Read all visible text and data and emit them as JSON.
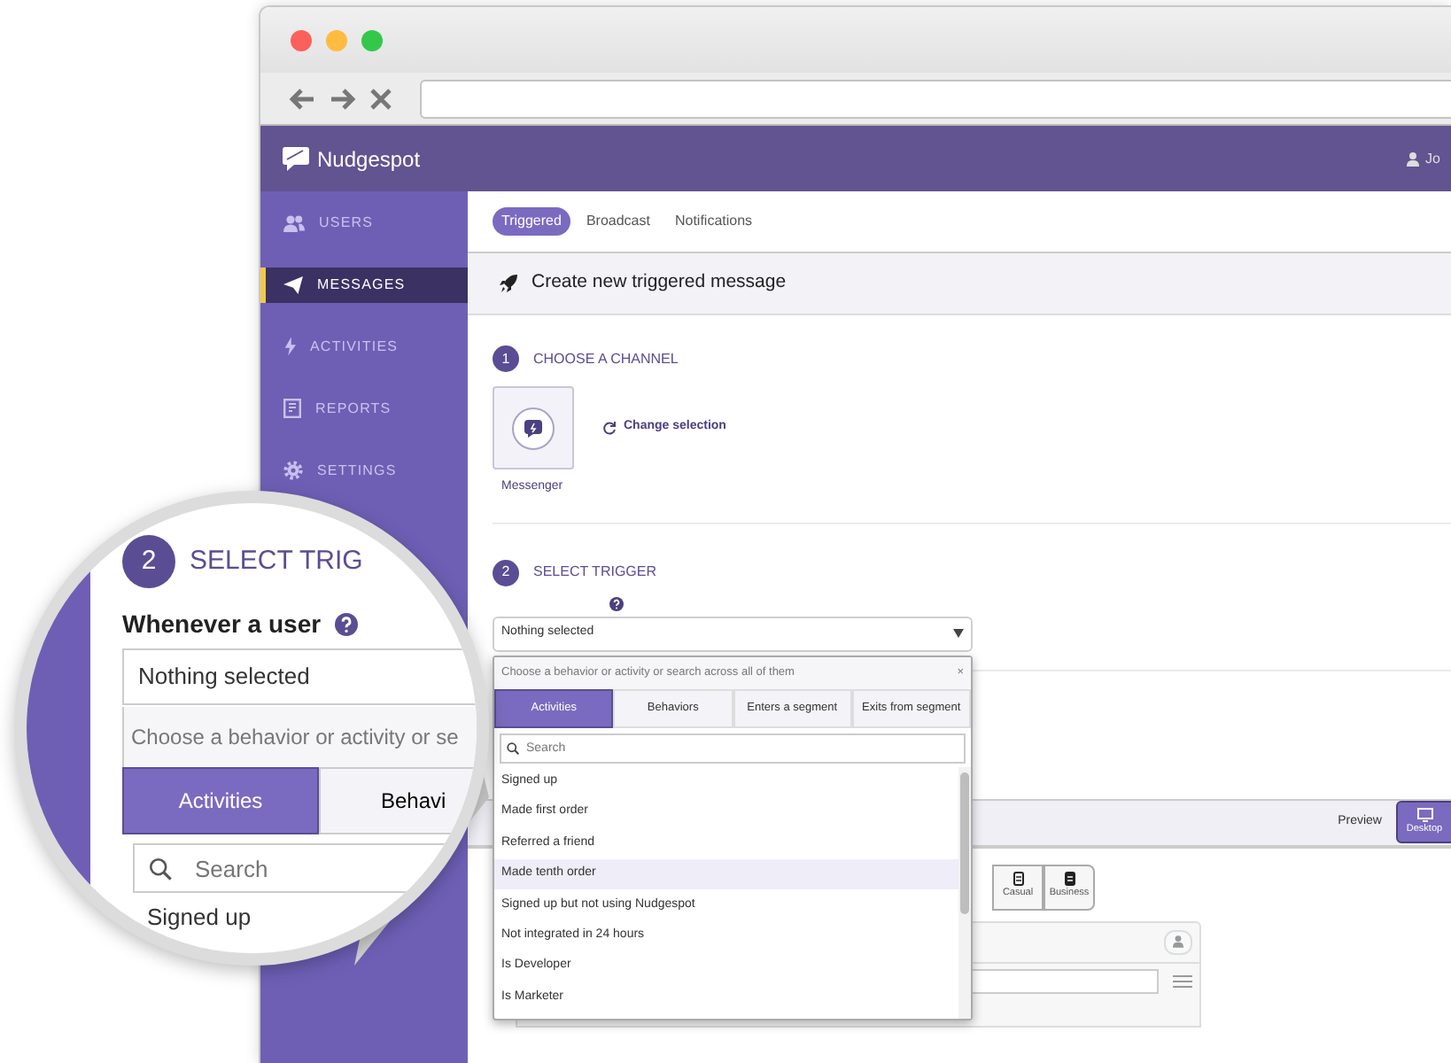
{
  "app": {
    "brand": "Nudgespot",
    "user": "Jo"
  },
  "sidebar": {
    "items": [
      {
        "label": "USERS",
        "selected": false
      },
      {
        "label": "MESSAGES",
        "selected": true
      },
      {
        "label": "ACTIVITIES",
        "selected": false
      },
      {
        "label": "REPORTS",
        "selected": false
      },
      {
        "label": "SETTINGS",
        "selected": false
      }
    ]
  },
  "tabs": [
    {
      "label": "Triggered",
      "selected": true
    },
    {
      "label": "Broadcast",
      "selected": false
    },
    {
      "label": "Notifications",
      "selected": false
    }
  ],
  "page_title": "Create new triggered message",
  "steps": [
    {
      "number": "1",
      "title": "CHOOSE A CHANNEL"
    },
    {
      "number": "2",
      "title": "SELECT TRIGGER"
    }
  ],
  "channel": {
    "label": "Messenger",
    "change_link": "Change selection"
  },
  "trigger_select": {
    "value": "Nothing selected",
    "open": true
  },
  "dropdown": {
    "hint": "Choose a behavior or activity or search across all of them",
    "close": "×",
    "tabs": [
      {
        "label": "Activities",
        "selected": true
      },
      {
        "label": "Behaviors",
        "selected": false
      },
      {
        "label": "Enters a segment",
        "selected": false
      },
      {
        "label": "Exits from segment",
        "selected": false
      }
    ],
    "search": {
      "placeholder": "Search"
    },
    "options": [
      {
        "label": "Signed up",
        "selected": false
      },
      {
        "label": "Made first order",
        "selected": false
      },
      {
        "label": "Referred a friend",
        "selected": false
      },
      {
        "label": "Made tenth order",
        "selected": true
      },
      {
        "label": "Signed up but not using Nudgespot",
        "selected": false
      },
      {
        "label": "Not integrated in 24 hours",
        "selected": false
      },
      {
        "label": "Is Developer",
        "selected": false
      },
      {
        "label": "Is Marketer",
        "selected": false
      }
    ]
  },
  "preview": {
    "label": "Preview",
    "modes": [
      {
        "label": "Desktop",
        "selected": true
      }
    ],
    "styles": [
      {
        "label": "Casual",
        "selected": false
      },
      {
        "label": "Business",
        "selected": false
      }
    ]
  },
  "magnifier": {
    "step_number": "2",
    "step_title": "SELECT TRIG",
    "field_label": "Whenever a user",
    "select_value": "Nothing selected",
    "hint": "Choose a behavior or activity or se",
    "tabs": [
      {
        "label": "Activities",
        "selected": true
      },
      {
        "label": "Behavi",
        "selected": false
      }
    ],
    "search_placeholder": "Search",
    "option": "Signed up"
  }
}
